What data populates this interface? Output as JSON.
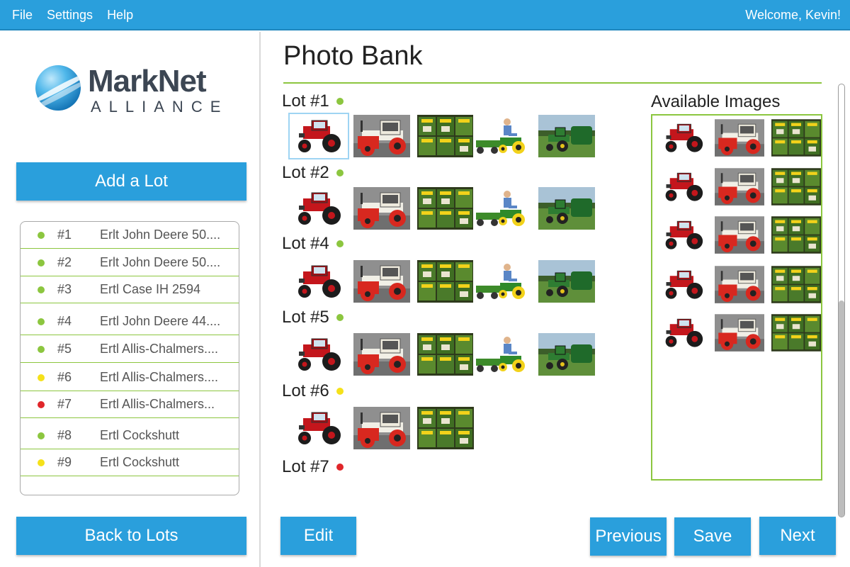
{
  "menu": {
    "file": "File",
    "settings": "Settings",
    "help": "Help"
  },
  "user": {
    "welcome": "Welcome, Kevin!"
  },
  "logo": {
    "line1": "MarkNet",
    "line2": "ALLIANCE"
  },
  "sidebar": {
    "add_lot_label": "Add a Lot",
    "back_label": "Back to Lots",
    "lots": [
      {
        "num": "#1",
        "name": "Erlt John Deere 50....",
        "status": "#8cc63f"
      },
      {
        "num": "#2",
        "name": "Erlt John Deere 50....",
        "status": "#8cc63f"
      },
      {
        "num": "#3",
        "name": "Ertl Case IH 2594",
        "status": "#8cc63f"
      },
      {
        "num": "#4",
        "name": "Ertl John Deere 44....",
        "status": "#8cc63f"
      },
      {
        "num": "#5",
        "name": "Ertl Allis-Chalmers....",
        "status": "#8cc63f"
      },
      {
        "num": "#6",
        "name": "Ertl Allis-Chalmers....",
        "status": "#f5e11a"
      },
      {
        "num": "#7",
        "name": "Ertl Allis-Chalmers...",
        "status": "#e0262a"
      },
      {
        "num": "#8",
        "name": "Ertl Cockshutt",
        "status": "#8cc63f"
      },
      {
        "num": "#9",
        "name": "Ertl Cockshutt",
        "status": "#f5e11a"
      }
    ]
  },
  "main": {
    "title": "Photo Bank",
    "available_title": "Available Images",
    "lot_groups": [
      {
        "label": "Lot #1",
        "status": "#8cc63f",
        "images": [
          "red-tractor",
          "white-tractor",
          "toy-boxes",
          "kid-on-tractor",
          "green-tractor"
        ]
      },
      {
        "label": "Lot #2",
        "status": "#8cc63f",
        "images": [
          "red-tractor",
          "white-tractor",
          "toy-boxes",
          "kid-on-tractor",
          "green-tractor"
        ]
      },
      {
        "label": "Lot #4",
        "status": "#8cc63f",
        "images": [
          "red-tractor",
          "white-tractor",
          "toy-boxes",
          "kid-on-tractor",
          "green-tractor"
        ]
      },
      {
        "label": "Lot #5",
        "status": "#8cc63f",
        "images": [
          "red-tractor",
          "white-tractor",
          "toy-boxes",
          "kid-on-tractor",
          "green-tractor"
        ]
      },
      {
        "label": "Lot #6",
        "status": "#f5e11a",
        "images": [
          "red-tractor",
          "white-tractor",
          "toy-boxes"
        ]
      },
      {
        "label": "Lot #7",
        "status": "#e0262a",
        "images": []
      }
    ],
    "available_images": [
      [
        "red-tractor",
        "white-tractor",
        "toy-boxes"
      ],
      [
        "red-tractor",
        "white-tractor",
        "toy-boxes"
      ],
      [
        "red-tractor",
        "white-tractor",
        "toy-boxes"
      ],
      [
        "red-tractor",
        "white-tractor",
        "toy-boxes"
      ],
      [
        "red-tractor",
        "white-tractor",
        "toy-boxes"
      ]
    ]
  },
  "actions": {
    "edit": "Edit",
    "previous": "Previous",
    "save": "Save",
    "next": "Next"
  },
  "colors": {
    "accent": "#2a9fdc",
    "rule": "#8cc63f"
  }
}
